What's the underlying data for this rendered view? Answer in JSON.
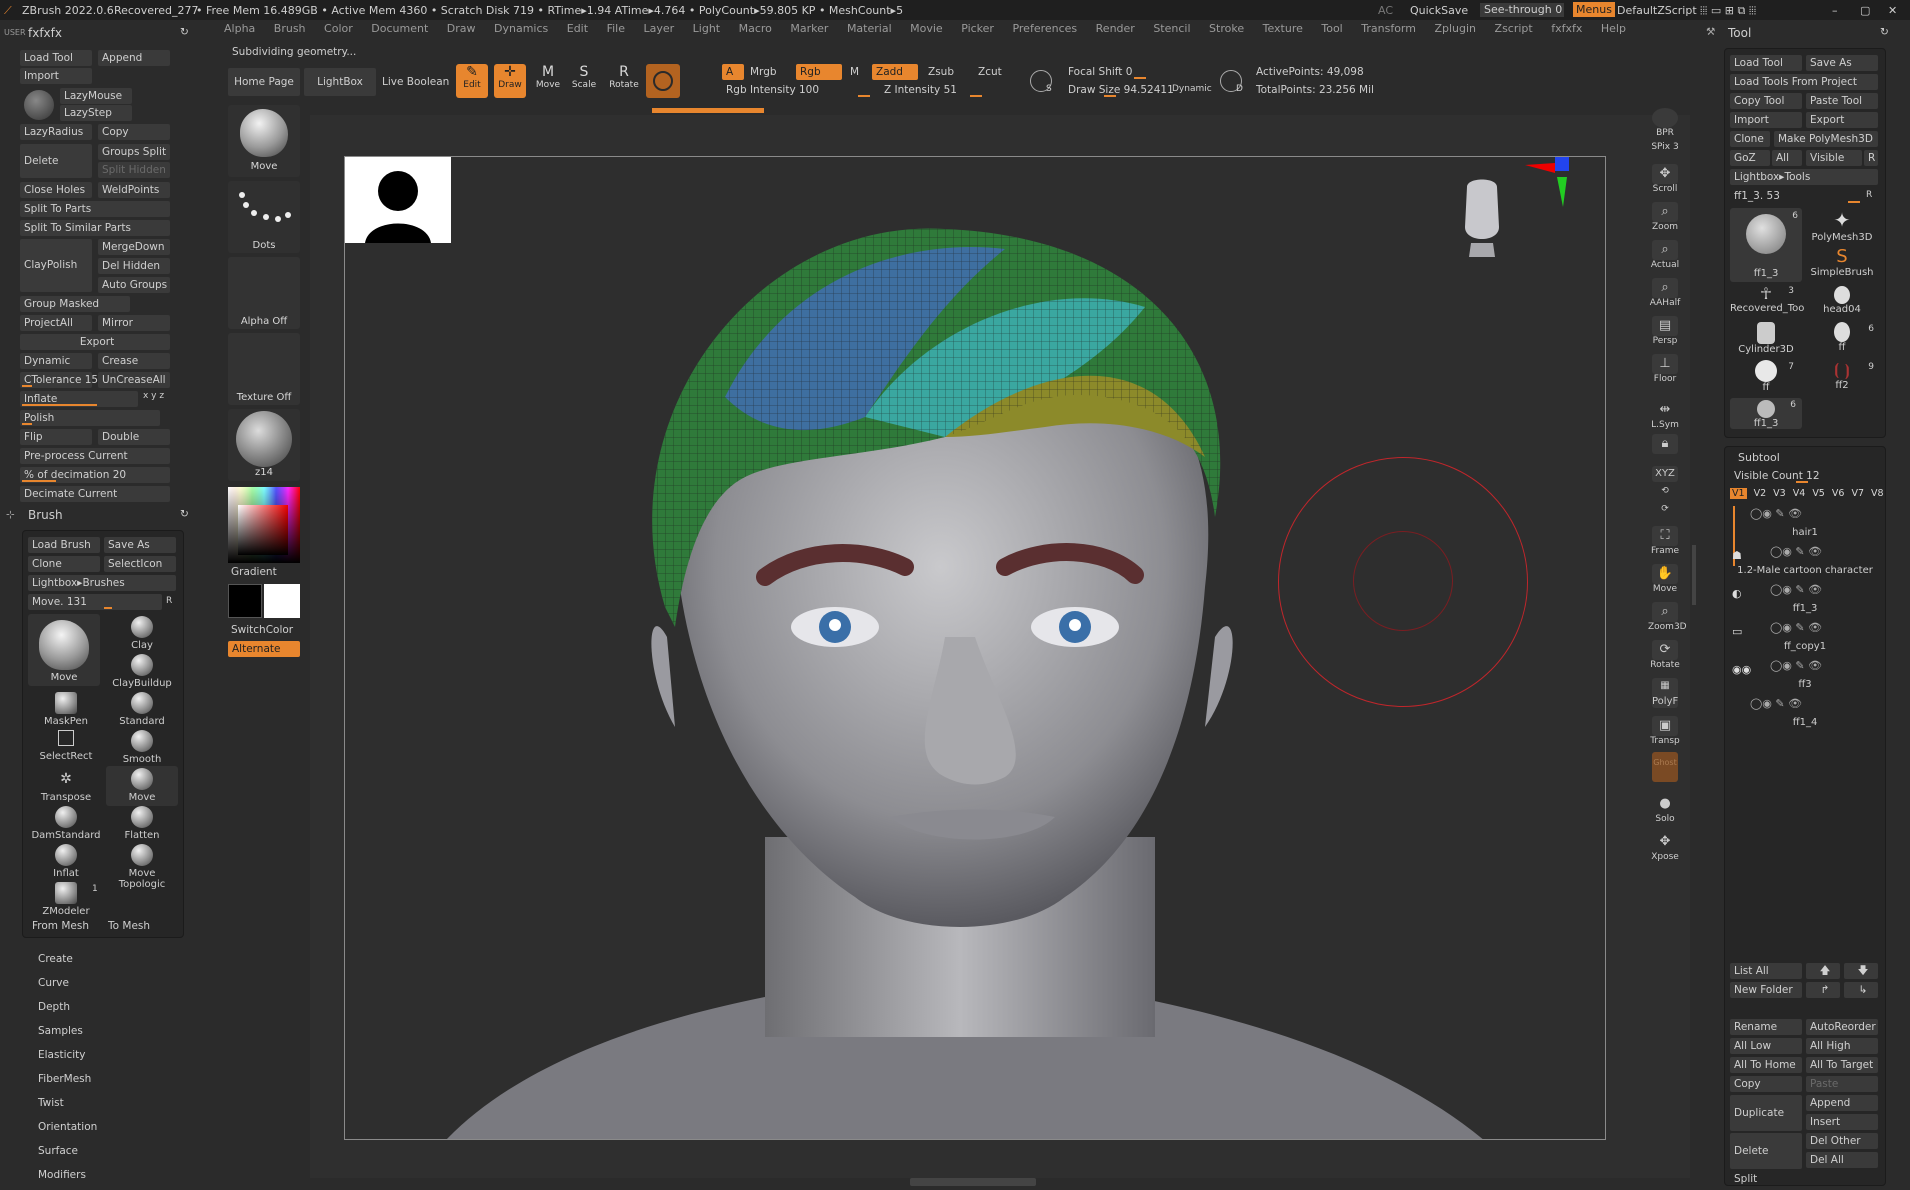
{
  "titlebar": {
    "app": "ZBrush 2022.0.6",
    "doc": "Recovered_277",
    "stats": "• Free Mem 16.489GB • Active Mem 4360 • Scratch Disk 719 •  RTime▸1.94 ATime▸4.764 • PolyCount▸59.805 KP  • MeshCount▸5",
    "ac": "AC",
    "quicksave": "QuickSave",
    "seethrough": "See-through  0",
    "menus": "Menus",
    "script": "DefaultZScript"
  },
  "menubar": [
    "Alpha",
    "Brush",
    "Color",
    "Document",
    "Draw",
    "Dynamics",
    "Edit",
    "File",
    "Layer",
    "Light",
    "Macro",
    "Marker",
    "Material",
    "Movie",
    "Picker",
    "Preferences",
    "Render",
    "Stencil",
    "Stroke",
    "Texture",
    "Tool",
    "Transform",
    "Zplugin",
    "Zscript",
    "fxfxfx",
    "Help"
  ],
  "status_msg": "Subdividing geometry...",
  "left": {
    "user": "USER",
    "title": "fxfxfx",
    "load_tool": "Load Tool",
    "append": "Append",
    "import": "Import",
    "lazymouse": "LazyMouse",
    "lazystep": "LazyStep",
    "lazyradius": "LazyRadius",
    "copy": "Copy",
    "delete": "Delete",
    "groups_split": "Groups Split",
    "split_hidden": "Split Hidden",
    "close_holes": "Close Holes",
    "weldpoints": "WeldPoints",
    "split_to_parts": "Split To Parts",
    "split_similar": "Split To Similar Parts",
    "claypolish": "ClayPolish",
    "mergedown": "MergeDown",
    "del_hidden": "Del Hidden",
    "auto_groups": "Auto Groups",
    "group_masked": "Group Masked",
    "projectall": "ProjectAll",
    "mirror": "Mirror",
    "export": "Export",
    "dynamic": "Dynamic",
    "crease": "Crease",
    "ctolerance": "CTolerance  15",
    "uncreaseall": "UnCreaseAll",
    "inflate": "Inflate",
    "xyz": "x y z",
    "polish": "Polish",
    "flip": "Flip",
    "double": "Double",
    "preprocess": "Pre-process Current",
    "decimation": "% of decimation  20",
    "decimate": "Decimate Current"
  },
  "brushpanel": {
    "title": "Brush",
    "load_brush": "Load Brush",
    "save_as": "Save As",
    "clone": "Clone",
    "selecticon": "SelectIcon",
    "lightbox": "Lightbox▸Brushes",
    "move": "Move.  131",
    "r": "R",
    "brushes": [
      "Move",
      "Clay",
      "ClayBuildup",
      "MaskPen",
      "Standard",
      "SelectRect",
      "Smooth",
      "Transpose",
      "Move",
      "DamStandard",
      "Flatten",
      "Inflat",
      "Move Topologic",
      "ZModeler"
    ],
    "zmodeler_count": "1",
    "from_mesh": "From Mesh",
    "to_mesh": "To Mesh",
    "sections": [
      "Create",
      "Curve",
      "Depth",
      "Samples",
      "Elasticity",
      "FiberMesh",
      "Twist",
      "Orientation",
      "Surface",
      "Modifiers"
    ]
  },
  "shelf": {
    "move": "Move",
    "dots": "Dots",
    "alpha_off": "Alpha Off",
    "texture_off": "Texture Off",
    "material": "z14",
    "gradient": "Gradient",
    "switchcolor": "SwitchColor",
    "alternate": "Alternate"
  },
  "toptoolbar": {
    "home": "Home Page",
    "lightbox": "LightBox",
    "live_boolean": "Live Boolean",
    "edit": "Edit",
    "draw": "Draw",
    "move": "Move",
    "scale": "Scale",
    "rotate": "Rotate",
    "a": "A",
    "mrgb": "Mrgb",
    "rgb": "Rgb",
    "m": "M",
    "zadd": "Zadd",
    "zsub": "Zsub",
    "zcut": "Zcut",
    "rgb_intensity": "Rgb Intensity  100",
    "z_intensity": "Z Intensity  51",
    "focal_shift": "Focal Shift  0",
    "draw_size": "Draw Size  94.52411",
    "dynamic": "Dynamic",
    "active_points": "ActivePoints: 49,098",
    "total_points": "TotalPoints: 23.256 Mil",
    "s": "S",
    "d": "D"
  },
  "rightbar": [
    "BPR",
    "SPix 3",
    "Scroll",
    "Zoom",
    "Actual",
    "AAHalf",
    "Persp",
    "Floor",
    "L.Sym",
    "",
    "XYZ",
    "",
    "",
    "Frame",
    "Move",
    "Zoom3D",
    "Rotate",
    "PolyF",
    "Transp",
    "Ghost",
    "Solo",
    "Xpose"
  ],
  "toolpanel": {
    "title": "Tool",
    "load_tool": "Load Tool",
    "save_as": "Save As",
    "load_from_project": "Load Tools From Project",
    "copy_tool": "Copy Tool",
    "paste_tool": "Paste Tool",
    "import": "Import",
    "export": "Export",
    "clone": "Clone",
    "make_polymesh": "Make PolyMesh3D",
    "goz": "GoZ",
    "all": "All",
    "visible": "Visible",
    "r": "R",
    "lightbox_tools": "Lightbox▸Tools",
    "current": "ff1_3.  53",
    "thumbs": [
      {
        "name": "ff1_3",
        "count": "6"
      },
      {
        "name": "PolyMesh3D",
        "count": ""
      },
      {
        "name": "SimpleBrush",
        "count": ""
      },
      {
        "name": "Recovered_Too",
        "count": "3"
      },
      {
        "name": "head04",
        "count": ""
      },
      {
        "name": "Cylinder3D",
        "count": ""
      },
      {
        "name": "ff",
        "count": "6"
      },
      {
        "name": "ff",
        "count": "7"
      },
      {
        "name": "ff2",
        "count": "9"
      },
      {
        "name": "ff1_3",
        "count": "6"
      }
    ]
  },
  "subtool": {
    "title": "Subtool",
    "visible_count": "Visible Count  12",
    "versions": [
      "V1",
      "V2",
      "V3",
      "V4",
      "V5",
      "V6",
      "V7",
      "V8"
    ],
    "items": [
      "hair1",
      "1.2-Male cartoon character",
      "ff1_3",
      "ff_copy1",
      "ff3",
      "ff1_4"
    ],
    "list_all": "List All",
    "new_folder": "New Folder",
    "rename": "Rename",
    "autoreorder": "AutoReorder",
    "all_low": "All Low",
    "all_high": "All High",
    "all_to_home": "All To Home",
    "all_to_target": "All To Target",
    "copy": "Copy",
    "paste": "Paste",
    "duplicate": "Duplicate",
    "append": "Append",
    "insert": "Insert",
    "delete": "Delete",
    "del_other": "Del Other",
    "del_all": "Del All",
    "split": "Split"
  },
  "colors": {
    "accent": "#e8862e",
    "bg": "#2b2b2b",
    "panel": "#262626",
    "button": "#3a3a3a"
  }
}
